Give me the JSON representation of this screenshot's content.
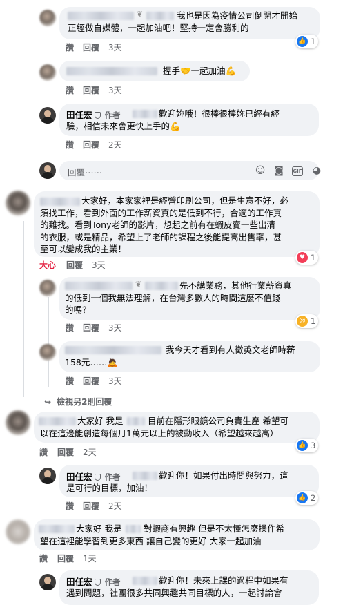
{
  "comments": [
    {
      "text": "我也是因為疫情公司倒閉才開始\n正經做自媒體，一起加油吧！堅持一定會勝利的",
      "like": "讚",
      "reply": "回覆",
      "time": "3天",
      "reactions": "1"
    },
    {
      "text": "握手🤝一起加油💪",
      "like": "讚",
      "reply": "回覆",
      "time": "3天"
    },
    {
      "author": "田任宏",
      "author_tag": "作者",
      "text": "歡迎妳哦！很棒很棒妳已經有經\n驗，相信未來會更快上手的💪",
      "like": "讚",
      "reply": "回覆",
      "time": "2天"
    },
    {
      "text": "大家好，本家家裡是經營印刷公司，但是生意不好，必\n須找工作，看到外面的工作薪資真的是低到不行，合適的工作真\n的難找。看到Tony老師的影片，想起之前有在蝦皮賣一些出清\n的衣服，或是精品，希望上了老師的課程之後能提高出售率，甚\n至可以變成我的主業！",
      "like": "大心",
      "reply": "回覆",
      "time": "3天",
      "reactions": "1"
    },
    {
      "text": "先不講業務，其他行業薪資真\n的低到一個我無法理解，在台灣多數人的時間這麼不值錢\n的嗎？",
      "like": "讚",
      "reply": "回覆",
      "time": "3天",
      "reactions": "1"
    },
    {
      "text": "我今天才看到有人徵英文老師時薪\n158元……🙇",
      "like": "讚",
      "reply": "回覆",
      "time": "3天"
    },
    {
      "text": "大家好 我是",
      "text2": "目前在隱形眼鏡公司負責生產 希望可\n以在這邊能創造每個月1萬元以上的被動收入（希望越來越高）",
      "like": "讚",
      "reply": "回覆",
      "time": "2天",
      "reactions": "3"
    },
    {
      "author": "田任宏",
      "author_tag": "作者",
      "text": "歡迎你！如果付出時間與努力，這\n是可行的目標，加油！",
      "like": "讚",
      "reply": "回覆",
      "time": "2天",
      "reactions": "2"
    },
    {
      "text": "大家好 我是",
      "text2": "對蝦商有興趣 但是不太懂怎麼操作希\n望在這裡能學習到更多東西 讓自己變的更好 大家一起加油",
      "like": "讚",
      "reply": "回覆",
      "time": "1天"
    },
    {
      "author": "田任宏",
      "author_tag": "作者",
      "text": "歡迎你！未來上課的過程中如果有\n遇到問題，社團很多共同興趣共同目標的人，一起討論會"
    }
  ],
  "reply_box": {
    "placeholder": "回覆⋯⋯"
  },
  "view_more": "檢視另2則回覆"
}
